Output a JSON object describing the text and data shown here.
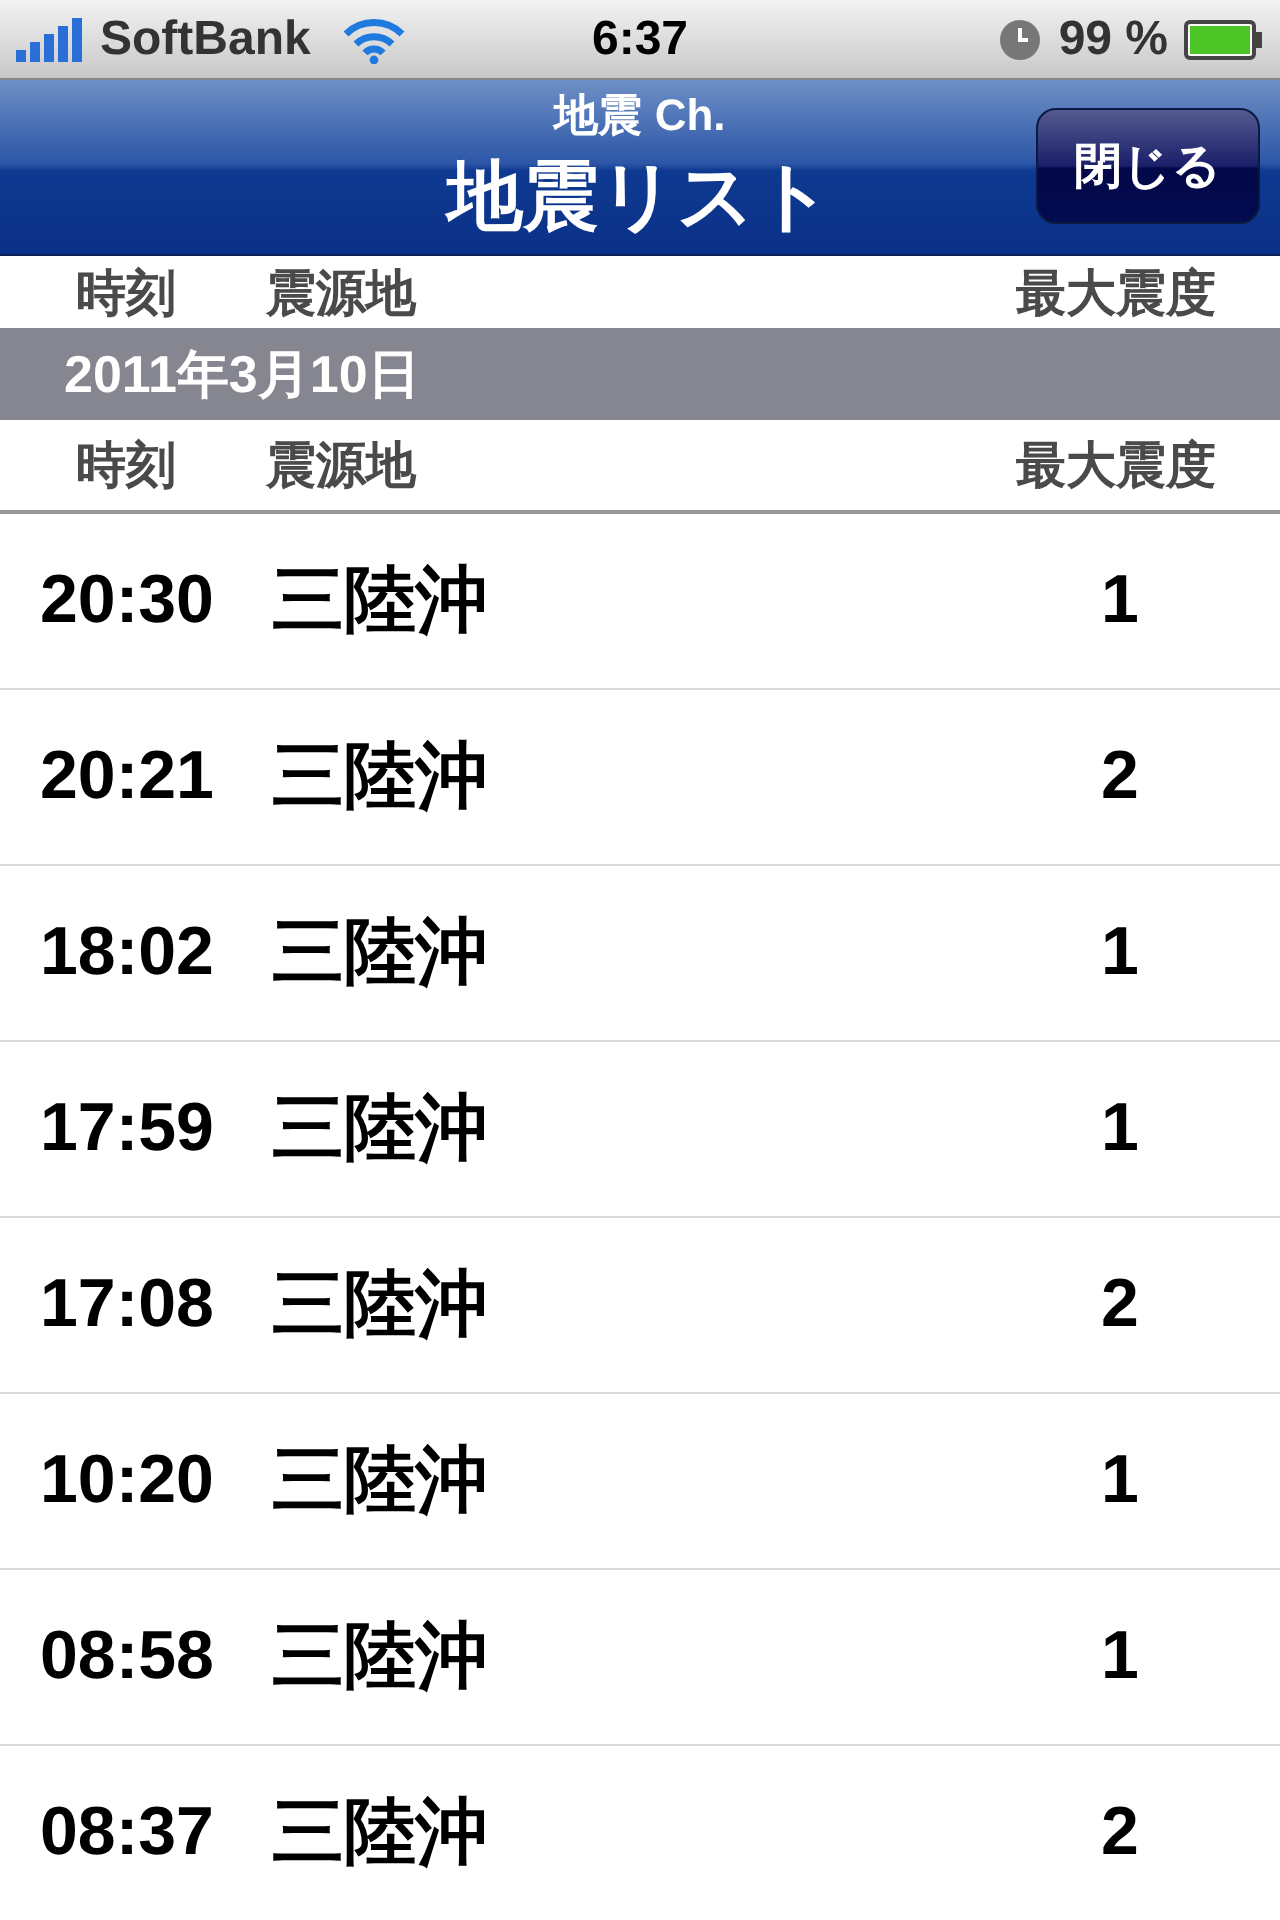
{
  "status_bar": {
    "carrier": "SoftBank",
    "time": "6:37",
    "battery": "99 %"
  },
  "nav": {
    "subtitle": "地震 Ch.",
    "title": "地震リスト",
    "close_button": "閉じる"
  },
  "sticky_header": {
    "time": "時刻",
    "place": "震源地",
    "intensity": "最大震度"
  },
  "section": {
    "date": "2011年3月10日",
    "header": {
      "time": "時刻",
      "place": "震源地",
      "intensity": "最大震度"
    },
    "rows": [
      {
        "time": "20:30",
        "place": "三陸沖",
        "intensity": "1"
      },
      {
        "time": "20:21",
        "place": "三陸沖",
        "intensity": "2"
      },
      {
        "time": "18:02",
        "place": "三陸沖",
        "intensity": "1"
      },
      {
        "time": "17:59",
        "place": "三陸沖",
        "intensity": "1"
      },
      {
        "time": "17:08",
        "place": "三陸沖",
        "intensity": "2"
      },
      {
        "time": "10:20",
        "place": "三陸沖",
        "intensity": "1"
      },
      {
        "time": "08:58",
        "place": "三陸沖",
        "intensity": "1"
      },
      {
        "time": "08:37",
        "place": "三陸沖",
        "intensity": "2"
      }
    ]
  }
}
